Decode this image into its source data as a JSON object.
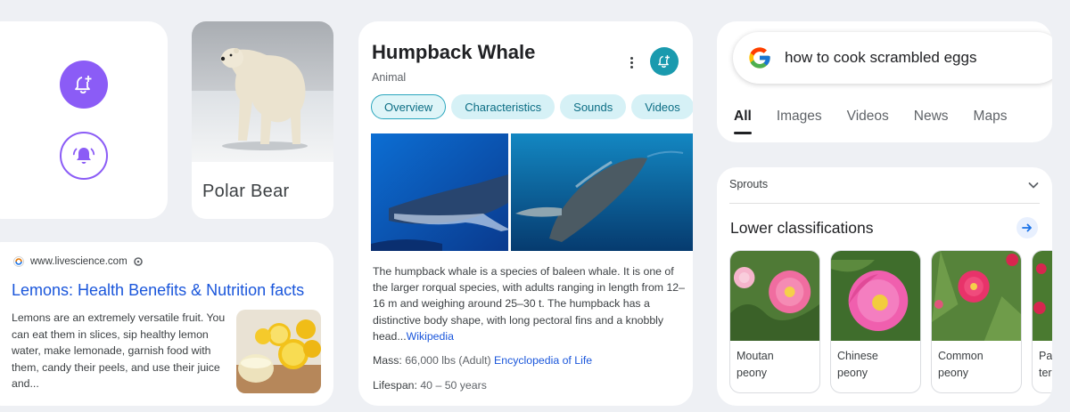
{
  "polar_bear": {
    "label": "Polar Bear"
  },
  "lemons": {
    "source": "www.livescience.com",
    "title": "Lemons: Health Benefits & Nutrition facts",
    "snippet": "Lemons are an extremely versatile fruit. You can eat them in slices, sip healthy lemon water, make lemonade, garnish food with them, candy their peels, and use their juice and..."
  },
  "whale": {
    "title": "Humpback Whale",
    "subtitle": "Animal",
    "tabs": [
      "Overview",
      "Characteristics",
      "Sounds",
      "Videos"
    ],
    "description": "The humpback whale is a species of baleen whale. It is one of the larger rorqual species, with adults ranging in length from 12–16 m and weighing around 25–30 t. The humpback has a distinctive body shape, with long pectoral fins and a knobbly head...",
    "description_link": "Wikipedia",
    "mass_label": "Mass:",
    "mass_value": "66,000 lbs (Adult)",
    "mass_link": "Encyclopedia of Life",
    "lifespan_label": "Lifespan:",
    "lifespan_value": "40 – 50 years"
  },
  "search": {
    "query": "how to cook scrambled eggs",
    "tabs": [
      "All",
      "Images",
      "Videos",
      "News",
      "Maps"
    ]
  },
  "sprouts": {
    "header": "Sprouts",
    "section_title": "Lower classifications",
    "items": [
      {
        "line1": "Moutan",
        "line2": "peony"
      },
      {
        "line1": "Chinese",
        "line2": "peony"
      },
      {
        "line1": "Common",
        "line2": "peony"
      },
      {
        "line1": "Pa",
        "line2": "ter"
      }
    ]
  },
  "colors": {
    "accent_purple": "#8b5cf6",
    "teal": "#1a9aae",
    "link_blue": "#1a56db"
  }
}
